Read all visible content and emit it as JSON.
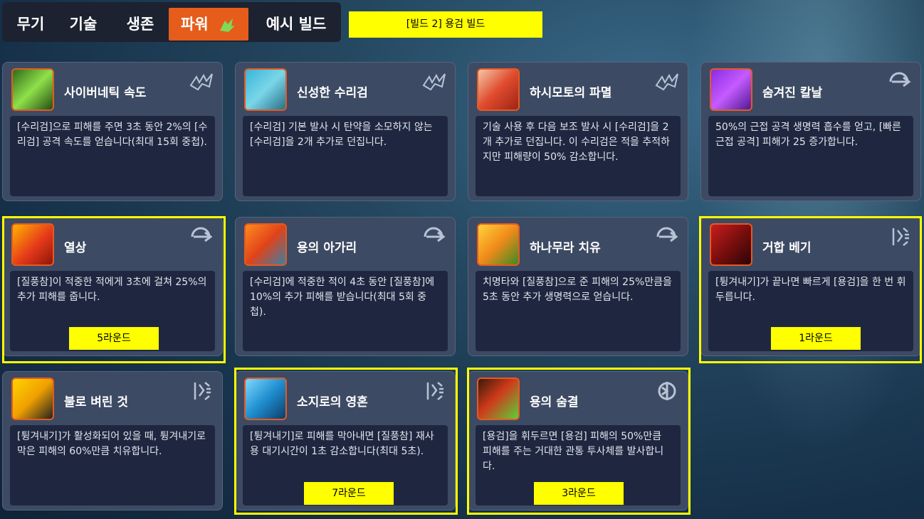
{
  "tabs": [
    {
      "label": "무기"
    },
    {
      "label": "기술"
    },
    {
      "label": "생존"
    },
    {
      "label": "파워",
      "active": true
    },
    {
      "label": "예시 빌드"
    }
  ],
  "build_label": "[빌드 2] 용검 빌드",
  "cards": [
    {
      "title": "사이버네틱 속도",
      "desc": "[수리검]으로 피해를 주면 3초 동안 2%의 [수리검] 공격 속도를 얻습니다(최대 15회 중첩).",
      "type_icon": "shuriken-icon",
      "round": ""
    },
    {
      "title": "신성한 수리검",
      "desc": "[수리검] 기본 발사 시 탄약을 소모하지 않는 [수리검]을 2개 추가로 던집니다.",
      "type_icon": "shuriken-icon",
      "round": ""
    },
    {
      "title": "하시모토의 파멸",
      "desc": "기술 사용 후 다음 보조 발사 시 [수리검]을 2개 추가로 던집니다. 이 수리검은 적을 추적하지만 피해량이 50% 감소합니다.",
      "type_icon": "shuriken-icon",
      "round": ""
    },
    {
      "title": "숨겨진 칼날",
      "desc": "50%의 근접 공격 생명력 흡수를 얻고, [빠른 근접 공격] 피해가 25 증가합니다.",
      "type_icon": "dash-icon",
      "round": ""
    },
    {
      "title": "열상",
      "desc": "[질풍참]이 적중한 적에게 3초에 걸쳐 25%의 추가 피해를 줍니다.",
      "type_icon": "dash-icon",
      "round": "5라운드"
    },
    {
      "title": "용의 아가리",
      "desc": "[수리검]에 적중한 적이 4초 동안 [질풍참]에 10%의 추가 피해를 받습니다(최대 5회 중첩).",
      "type_icon": "dash-icon",
      "round": ""
    },
    {
      "title": "하나무라 치유",
      "desc": "치명타와 [질풍참]으로 준 피해의 25%만큼을 5초 동안 추가 생명력으로 얻습니다.",
      "type_icon": "dash-icon",
      "round": ""
    },
    {
      "title": "거합 베기",
      "desc": "[튕겨내기]가 끝나면 빠르게 [용검]을 한 번 휘두릅니다.",
      "type_icon": "deflect-icon",
      "round": "1라운드"
    },
    {
      "title": "불로 벼린 것",
      "desc": "[튕겨내기]가 활성화되어 있을 때, 튕겨내기로 막은 피해의 60%만큼 치유합니다.",
      "type_icon": "deflect-icon",
      "round": ""
    },
    {
      "title": "소지로의 영혼",
      "desc": "[튕겨내기]로 피해를 막아내면 [질풍참] 재사용 대기시간이 1초 감소합니다(최대 5초).",
      "type_icon": "deflect-icon",
      "round": "7라운드"
    },
    {
      "title": "용의 숨결",
      "desc": "[용검]을 휘두르면 [용검] 피해의 50%만큼 피해를 주는 거대한 관통 투사체를 발사합니다.",
      "type_icon": "dragonblade-icon",
      "round": "3라운드"
    }
  ]
}
